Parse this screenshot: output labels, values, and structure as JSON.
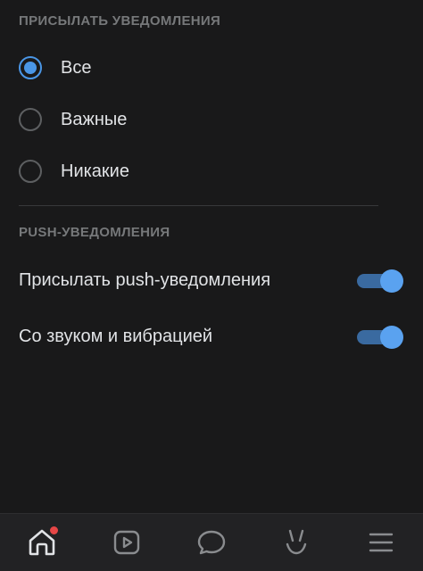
{
  "notifications": {
    "header": "ПРИСЫЛАТЬ УВЕДОМЛЕНИЯ",
    "options": [
      {
        "label": "Все",
        "selected": true
      },
      {
        "label": "Важные",
        "selected": false
      },
      {
        "label": "Никакие",
        "selected": false
      }
    ]
  },
  "push": {
    "header": "PUSH-УВЕДОМЛЕНИЯ",
    "settings": [
      {
        "label": "Присылать push-уведомления",
        "enabled": true
      },
      {
        "label": "Со звуком и вибрацией",
        "enabled": true
      }
    ]
  },
  "tabbar": {
    "items": [
      {
        "icon": "home-icon",
        "active": true,
        "has_badge": true
      },
      {
        "icon": "video-play-icon",
        "active": false,
        "has_badge": false
      },
      {
        "icon": "chat-bubble-icon",
        "active": false,
        "has_badge": false
      },
      {
        "icon": "clips-icon",
        "active": false,
        "has_badge": false
      },
      {
        "icon": "menu-icon",
        "active": false,
        "has_badge": false
      }
    ]
  },
  "colors": {
    "background": "#19191a",
    "accent": "#4a96e6",
    "badge": "#e64646"
  }
}
